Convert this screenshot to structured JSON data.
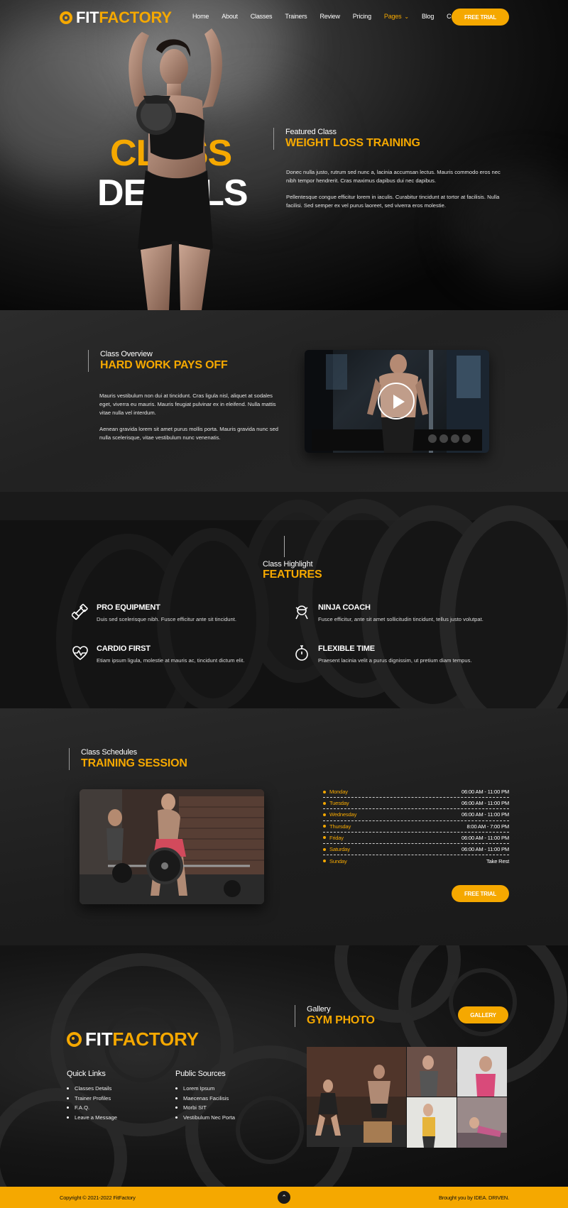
{
  "brand": {
    "part1": "FIT",
    "part2": "FACTORY"
  },
  "nav": {
    "items": [
      "Home",
      "About",
      "Classes",
      "Trainers",
      "Review",
      "Pricing",
      "Pages",
      "Blog",
      "Contact"
    ],
    "active": "Pages",
    "cta": "FREE TRIAL"
  },
  "hero": {
    "big_line1": "CLASS",
    "big_line2": "DETAILS",
    "subtitle": "Featured Class",
    "title": "WEIGHT LOSS TRAINING",
    "para1": "Donec nulla justo, rutrum sed nunc a, lacinia accumsan lectus. Mauris commodo eros nec nibh tempor hendrerit. Cras maximus dapibus dui nec dapibus.",
    "para2": "Pellentesque congue efficitur lorem in iaculis. Curabitur tincidunt at tortor at facilisis. Nulla facilisi. Sed semper ex vel purus laoreet, sed viverra eros molestie."
  },
  "overview": {
    "subtitle": "Class Overview",
    "title": "HARD WORK PAYS OFF",
    "para1": "Mauris vestibulum non dui at tincidunt. Cras ligula nisl, aliquet at sodales eget, viverra eu mauris. Mauris feugiat pulvinar ex in eleifend. Nulla mattis vitae nulla vel interdum.",
    "para2": "Aenean gravida lorem sit amet purus mollis porta. Mauris gravida nunc sed nulla scelerisque, vitae vestibulum nunc venenatis."
  },
  "features": {
    "subtitle": "Class Highlight",
    "title": "FEATURES",
    "items": [
      {
        "icon": "dumbbell-icon",
        "title": "PRO EQUIPMENT",
        "desc": "Duis sed scelerisque nibh. Fusce efficitur ante sit tincidunt."
      },
      {
        "icon": "ninja-icon",
        "title": "NINJA COACH",
        "desc": "Fusce efficitur, ante sit amet sollicitudin tincidunt, tellus justo volutpat."
      },
      {
        "icon": "heartbeat-icon",
        "title": "CARDIO FIRST",
        "desc": "Etiam ipsum ligula, molestie at mauris ac, tincidunt dictum elit."
      },
      {
        "icon": "stopwatch-icon",
        "title": "FLEXIBLE TIME",
        "desc": "Praesent lacinia velit a purus dignissim, ut pretium diam tempus."
      }
    ]
  },
  "schedule": {
    "subtitle": "Class Schedules",
    "title": "TRAINING SESSION",
    "rows": [
      {
        "day": "Monday",
        "time": "06:00 AM - 11:00 PM"
      },
      {
        "day": "Tuesday",
        "time": "06:00 AM - 11:00 PM"
      },
      {
        "day": "Wednesday",
        "time": "06:00 AM - 11:00 PM"
      },
      {
        "day": "Thursday",
        "time": "8:00 AM - 7:00 PM"
      },
      {
        "day": "Friday",
        "time": "06:00 AM - 11:00 PM"
      },
      {
        "day": "Saturday",
        "time": "06:00 AM - 11:00 PM"
      },
      {
        "day": "Sunday",
        "time": "Take Rest"
      }
    ],
    "cta": "FREE TRIAL"
  },
  "footer": {
    "quick_title": "Quick Links",
    "quick": [
      "Classes Details",
      "Trainer Profiles",
      "F.A.Q.",
      "Leave a Message"
    ],
    "public_title": "Public Sources",
    "public": [
      "Lorem Ipsum",
      "Maecenas Facilisis",
      "Morbi SIT",
      "Vestibulum Nec Porta"
    ],
    "gallery_subtitle": "Gallery",
    "gallery_title": "GYM PHOTO",
    "gallery_cta": "GALLERY"
  },
  "bottom": {
    "copyright": "Copyright © 2021-2022 FitFactory",
    "credit": "Brought you by IDEA. DRIVEN."
  },
  "colors": {
    "accent": "#f5a800"
  }
}
